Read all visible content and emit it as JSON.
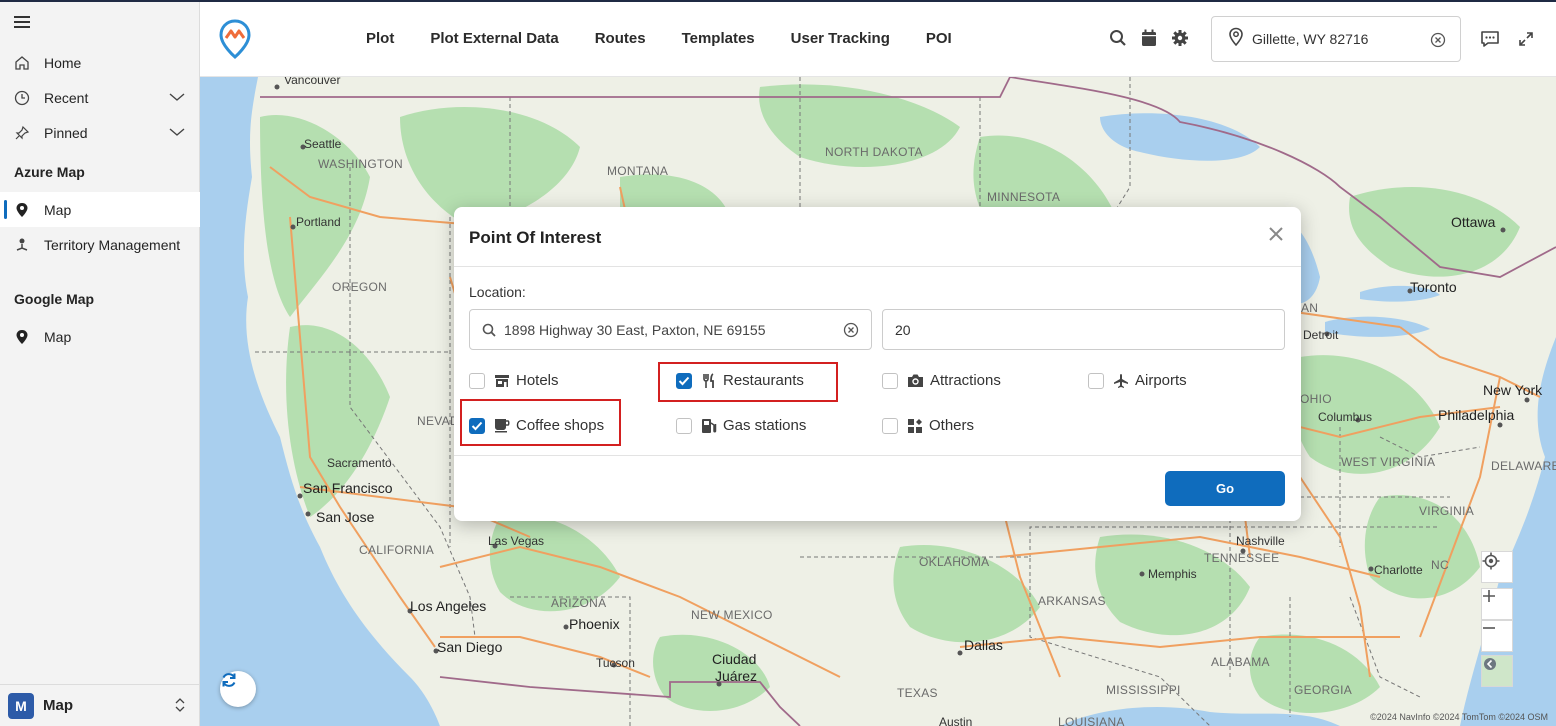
{
  "sidebar": {
    "items": [
      {
        "label": "Home",
        "icon": "home-icon"
      },
      {
        "label": "Recent",
        "icon": "clock-icon"
      },
      {
        "label": "Pinned",
        "icon": "pin-icon"
      }
    ],
    "section_azure": "Azure Map",
    "azure_items": [
      {
        "label": "Map",
        "icon": "map-marker-icon"
      },
      {
        "label": "Territory Management",
        "icon": "territory-icon"
      }
    ],
    "section_google": "Google Map",
    "google_items": [
      {
        "label": "Map",
        "icon": "map-marker-icon"
      }
    ],
    "footer": {
      "badge": "M",
      "label": "Map"
    }
  },
  "topbar": {
    "menu": [
      "Plot",
      "Plot External Data",
      "Routes",
      "Templates",
      "User Tracking",
      "POI"
    ],
    "location_value": "Gillette, WY 82716"
  },
  "modal": {
    "title": "Point Of Interest",
    "location_label": "Location:",
    "address_value": "1898 Highway 30 East, Paxton, NE 69155",
    "radius_value": "20",
    "categories": [
      {
        "label": "Hotels",
        "checked": false,
        "icon": "store-icon"
      },
      {
        "label": "Restaurants",
        "checked": true,
        "icon": "fork-knife-icon"
      },
      {
        "label": "Attractions",
        "checked": false,
        "icon": "camera-icon"
      },
      {
        "label": "Airports",
        "checked": false,
        "icon": "plane-icon"
      },
      {
        "label": "Coffee shops",
        "checked": true,
        "icon": "coffee-icon"
      },
      {
        "label": "Gas stations",
        "checked": false,
        "icon": "gas-pump-icon"
      },
      {
        "label": "Others",
        "checked": false,
        "icon": "grid-icon"
      }
    ],
    "go_label": "Go"
  },
  "map": {
    "labels": {
      "vancouver": "Vancouver",
      "seattle": "Seattle",
      "washington": "WASHINGTON",
      "portland": "Portland",
      "oregon": "OREGON",
      "montana": "MONTANA",
      "north_dakota": "NORTH DAKOTA",
      "minnesota": "MINNESOTA",
      "ottawa": "Ottawa",
      "toronto": "Toronto",
      "detroit": "Detroit",
      "ohio": "OHIO",
      "columbus": "Columbus",
      "new_york": "New York",
      "philadelphia": "Philadelphia",
      "west_virginia": "WEST VIRGINIA",
      "delaware": "DELAWARE",
      "virginia": "VIRGINIA",
      "nashville": "Nashville",
      "tennessee": "TENNESSEE",
      "memphis": "Memphis",
      "charlotte": "Charlotte",
      "nc": "NC",
      "oklahoma": "OKLAHOMA",
      "arkansas": "ARKANSAS",
      "dallas": "Dallas",
      "texas": "TEXAS",
      "alabama": "ALABAMA",
      "mississippi": "MISSISSIPPI",
      "georgia": "GEORGIA",
      "louisiana": "LOUISIANA",
      "austin": "Austin",
      "nevada": "NEVAD",
      "sacramento": "Sacramento",
      "san_francisco": "San Francisco",
      "san_jose": "San Jose",
      "california": "CALIFORNIA",
      "las_vegas": "Las Vegas",
      "los_angeles": "Los Angeles",
      "arizona": "ARIZONA",
      "phoenix": "Phoenix",
      "san_diego": "San Diego",
      "tucson": "Tucson",
      "new_mexico": "NEW MEXICO",
      "ciudad_juarez_1": "Ciudad",
      "ciudad_juarez_2": "Juárez",
      "ian": "AN"
    },
    "copyright": "©2024 NavInfo ©2024 TomTom ©2024 OSM"
  },
  "colors": {
    "accent": "#0f6cbd",
    "highlight": "#d32020",
    "map_green": "#b5dfb0",
    "map_water": "#a9cfee"
  }
}
